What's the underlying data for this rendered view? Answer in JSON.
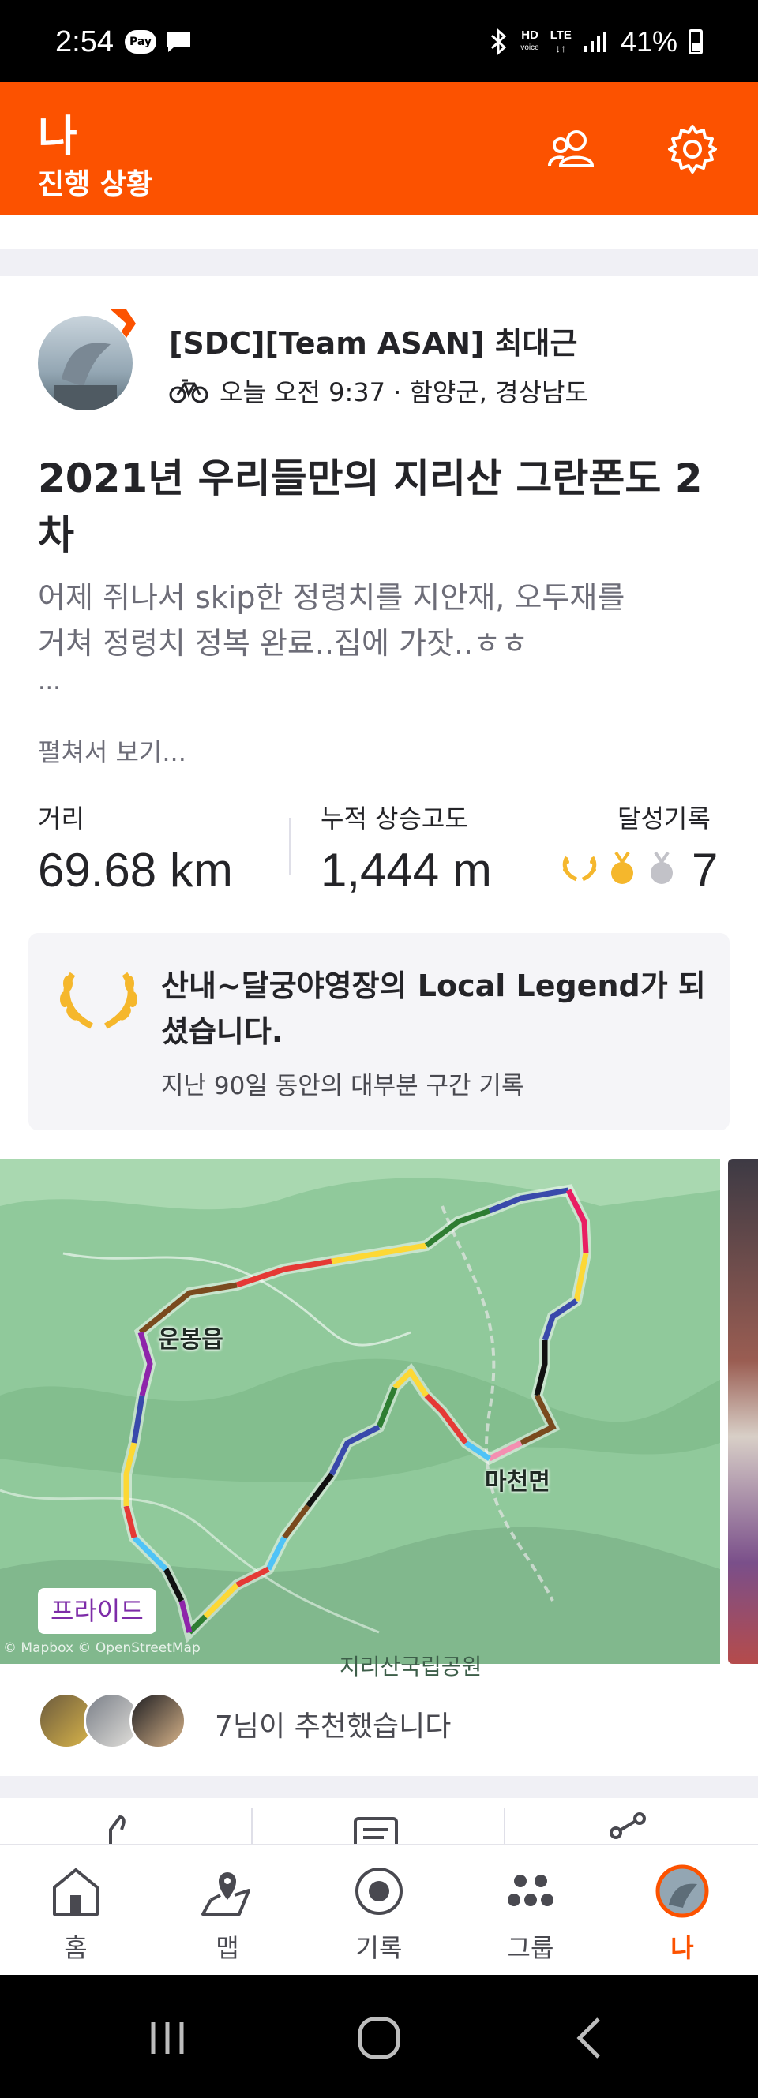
{
  "status_bar": {
    "time": "2:54",
    "pay_label": "Pay",
    "hd_label": "HD",
    "voice_label": "voice",
    "lte_label": "LTE",
    "battery": "41%"
  },
  "header": {
    "title": "나",
    "subtitle": "진행 상황"
  },
  "activity": {
    "athlete_name": "[SDC][Team ASAN] 최대근",
    "meta": "오늘 오전 9:37 · 함양군, 경상남도",
    "title": "2021년 우리들만의 지리산 그란폰도 2차",
    "description_line1": "어제 쥐나서 skip한 정령치를 지안재, 오두재를",
    "description_line2": "거쳐 정령치 정복 완료..집에 가잣..ㅎㅎ",
    "description_ellipsis": "...",
    "expand_label": "펼쳐서 보기..."
  },
  "stats": {
    "distance_label": "거리",
    "distance_value": "69.68 km",
    "elevation_label": "누적 상승고도",
    "elevation_value": "1,444 m",
    "achievements_label": "달성기록",
    "achievements_count": "7"
  },
  "local_legend": {
    "title": "산내~달궁야영장의  Local Legend가 되셨습니다.",
    "subtitle": "지난 90일 동안의 대부분 구간 기록"
  },
  "map": {
    "label_town1": "운봉읍",
    "label_town2": "마천면",
    "label_park": "지리산국립공원",
    "ride_badge": "프라이드",
    "attribution": "© Mapbox © OpenStreetMap"
  },
  "kudos": {
    "text": "7님이 추천했습니다"
  },
  "bottom_nav": {
    "items": [
      {
        "label": "홈"
      },
      {
        "label": "맵"
      },
      {
        "label": "기록"
      },
      {
        "label": "그룹"
      },
      {
        "label": "나"
      }
    ]
  },
  "colors": {
    "brand": "#fc5200",
    "gold": "#f5b72c",
    "silver": "#c2c2c8"
  }
}
